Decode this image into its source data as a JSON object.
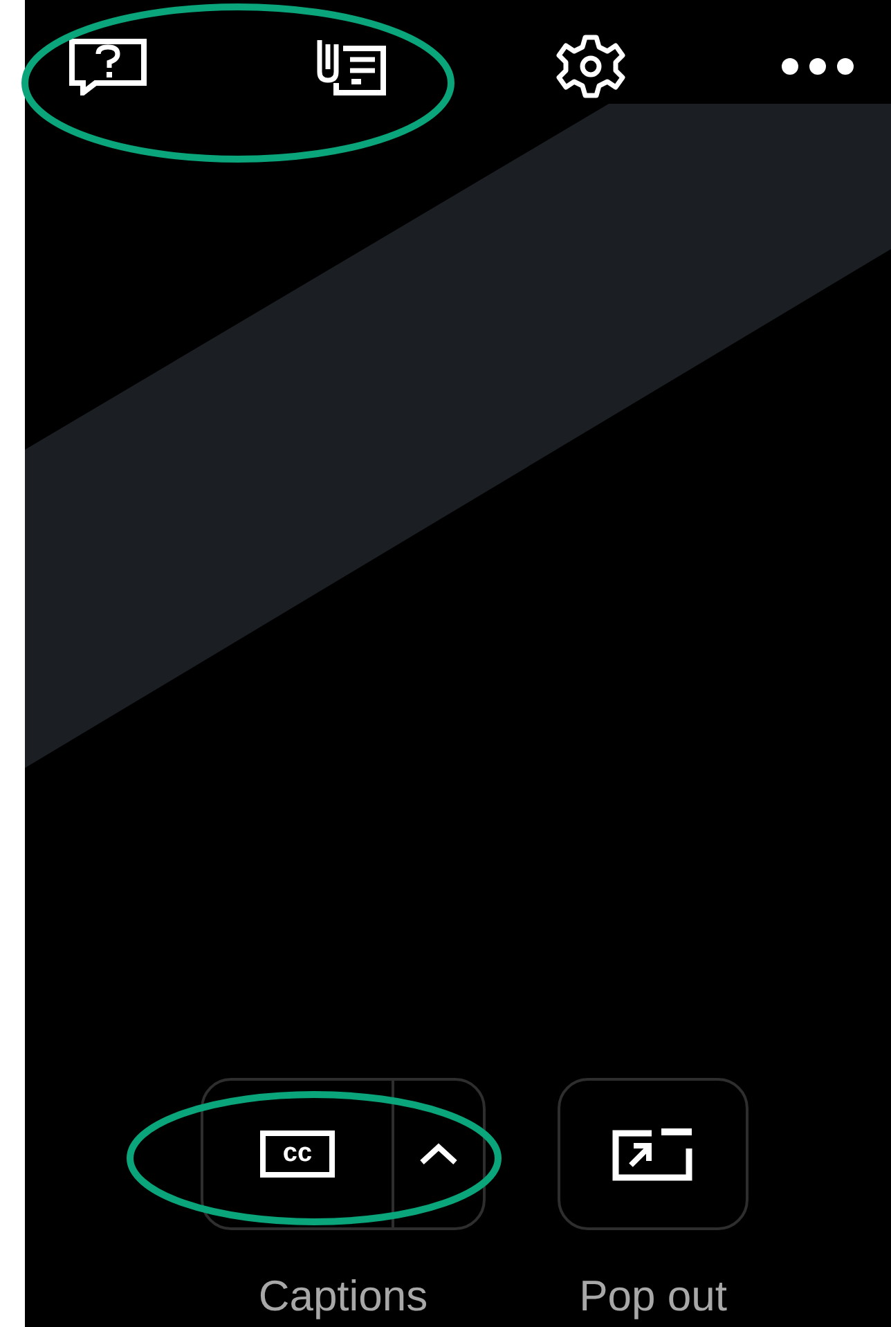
{
  "toolbar": {
    "buttons": [
      {
        "kind": "help"
      },
      {
        "kind": "notes"
      },
      {
        "kind": "settings"
      },
      {
        "kind": "more"
      }
    ]
  },
  "controls": [
    {
      "kind": "captions",
      "label": "Captions",
      "icon_text": "cc",
      "has_menu": true
    },
    {
      "kind": "popout",
      "label": "Pop out",
      "has_menu": false
    }
  ]
}
